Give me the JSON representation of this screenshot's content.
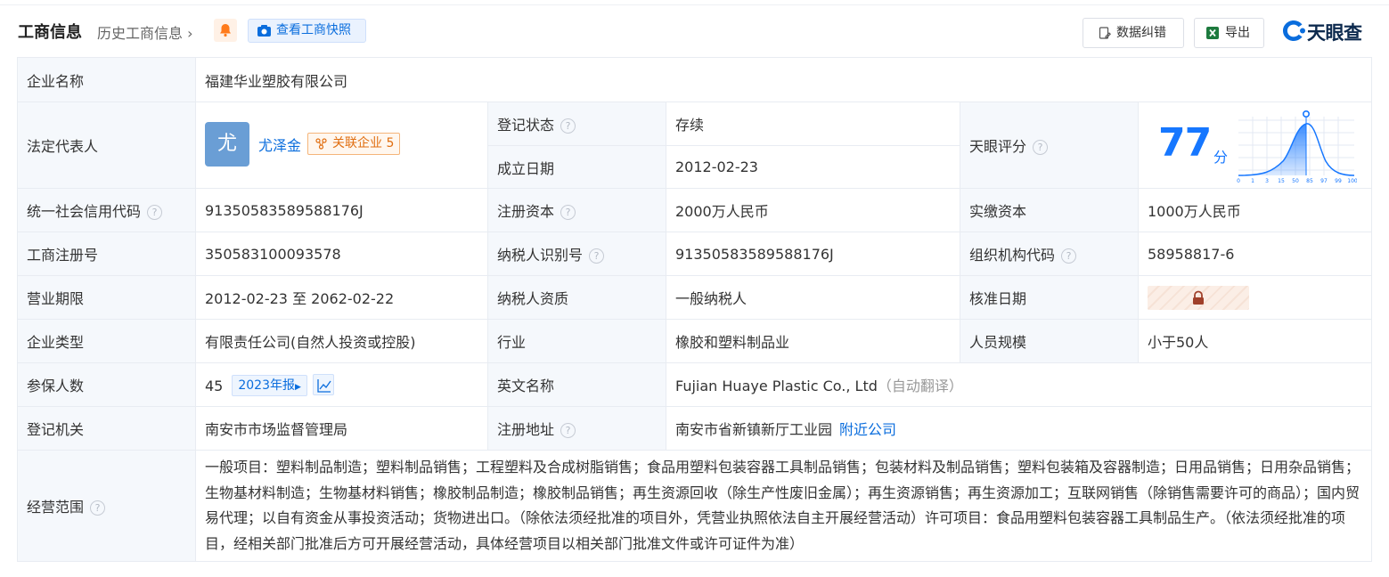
{
  "header": {
    "title": "工商信息",
    "history_link": "历史工商信息",
    "snapshot_button": "查看工商快照",
    "correct_button": "数据纠错",
    "export_button": "导出",
    "logo_text": "天眼查",
    "accent_color": "#0a6ddd"
  },
  "company": {
    "name_label": "企业名称",
    "name": "福建华业塑胶有限公司",
    "legal_rep_label": "法定代表人",
    "legal_rep_avatar": "尤",
    "legal_rep_name": "尤泽金",
    "related_label": "关联企业",
    "related_count": "5",
    "reg_status_label": "登记状态",
    "reg_status": "存续",
    "found_date_label": "成立日期",
    "found_date": "2012-02-23",
    "score_label": "天眼评分",
    "score": "77",
    "score_unit": "分",
    "score_ticks": [
      "0",
      "1",
      "3",
      "15",
      "50",
      "85",
      "97",
      "99",
      "100"
    ],
    "credit_code_label": "统一社会信用代码",
    "credit_code": "91350583589588176J",
    "reg_capital_label": "注册资本",
    "reg_capital": "2000万人民币",
    "paid_capital_label": "实缴资本",
    "paid_capital": "1000万人民币",
    "reg_no_label": "工商注册号",
    "reg_no": "350583100093578",
    "taxpayer_id_label": "纳税人识别号",
    "taxpayer_id": "91350583589588176J",
    "org_code_label": "组织机构代码",
    "org_code": "58958817-6",
    "term_label": "营业期限",
    "term": "2012-02-23 至 2062-02-22",
    "taxpayer_qual_label": "纳税人资质",
    "taxpayer_qual": "一般纳税人",
    "approve_date_label": "核准日期",
    "type_label": "企业类型",
    "type": "有限责任公司(自然人投资或控股)",
    "industry_label": "行业",
    "industry": "橡胶和塑料制品业",
    "staff_label": "人员规模",
    "staff": "小于50人",
    "insured_label": "参保人数",
    "insured": "45",
    "insured_year": "2023年报",
    "en_name_label": "英文名称",
    "en_name": "Fujian Huaye Plastic Co., Ltd",
    "en_name_note": "（自动翻译）",
    "authority_label": "登记机关",
    "authority": "南安市市场监督管理局",
    "address_label": "注册地址",
    "address": "南安市省新镇新厅工业园",
    "nearby_link": "附近公司",
    "scope_label": "经营范围",
    "scope": "一般项目：塑料制品制造；塑料制品销售；工程塑料及合成树脂销售；食品用塑料包装容器工具制品销售；包装材料及制品销售；塑料包装箱及容器制造；日用品销售；日用杂品销售；生物基材料制造；生物基材料销售；橡胶制品制造；橡胶制品销售；再生资源回收（除生产性废旧金属）；再生资源销售；再生资源加工；互联网销售（除销售需要许可的商品）；国内贸易代理；以自有资金从事投资活动；货物进出口。（除依法须经批准的项目外，凭营业执照依法自主开展经营活动）许可项目：食品用塑料包装容器工具制品生产。（依法须经批准的项目，经相关部门批准后方可开展经营活动，具体经营项目以相关部门批准文件或许可证件为准）"
  }
}
